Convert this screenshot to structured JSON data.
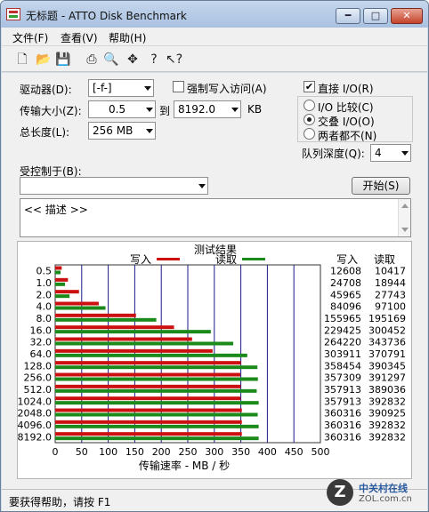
{
  "window": {
    "title": "无标题 - ATTO Disk Benchmark",
    "controls": {
      "minimize": "━",
      "maximize": "□",
      "close": "✕"
    }
  },
  "menu": [
    "文件(F)",
    "查看(V)",
    "帮助(H)"
  ],
  "toolbar_icons": [
    "new-icon",
    "open-icon",
    "save-icon",
    "print-icon",
    "print-preview-icon",
    "move-icon",
    "help-icon",
    "context-help-icon"
  ],
  "form": {
    "drive_label": "驱动器(D):",
    "drive_value": "[-f-]",
    "force_write_label": "强制写入访问(A)",
    "direct_io_label": "直接 I/O(R)",
    "transfer_size_label": "传输大小(Z):",
    "transfer_from": "0.5",
    "to_label": "到",
    "transfer_to": "8192.0",
    "kb_label": "KB",
    "total_length_label": "总长度(L):",
    "total_length_value": "256 MB",
    "radio_options": [
      "I/O 比较(C)",
      "交叠 I/O(O)",
      "两者都不(N)"
    ],
    "queue_depth_label": "队列深度(Q):",
    "queue_depth_value": "4",
    "controlled_by_label": "受控制于(B):",
    "controlled_by_value": "",
    "start_button": "开始(S)",
    "description": "<< 描述 >>"
  },
  "results": {
    "title": "测试结果",
    "legend_write": "写入",
    "legend_read": "读取",
    "col_write": "写入",
    "col_read": "读取",
    "xlabel": "传输速率 - MB / 秒"
  },
  "chart_data": {
    "type": "bar",
    "categories": [
      "0.5",
      "1.0",
      "2.0",
      "4.0",
      "8.0",
      "16.0",
      "32.0",
      "64.0",
      "128.0",
      "256.0",
      "512.0",
      "1024.0",
      "2048.0",
      "4096.0",
      "8192.0"
    ],
    "series": [
      {
        "name": "写入",
        "values": [
          12608,
          24708,
          45965,
          84096,
          155965,
          229425,
          264220,
          303911,
          358454,
          357309,
          357913,
          357913,
          360316,
          360316,
          360316
        ]
      },
      {
        "name": "读取",
        "values": [
          10417,
          18944,
          27743,
          97100,
          195169,
          300452,
          343736,
          370791,
          390345,
          391297,
          389036,
          392832,
          390925,
          392832,
          392832
        ]
      }
    ],
    "xlim": [
      0,
      500
    ],
    "xticks": [
      "0",
      "50",
      "100",
      "150",
      "200",
      "250",
      "300",
      "350",
      "400",
      "450",
      "500"
    ],
    "units_values": "KB/s",
    "xlabel": "传输速率 - MB / 秒",
    "colors": {
      "write": "#cc1010",
      "read": "#1a8a1a",
      "grid": "#1a1a8a"
    },
    "legend": "top"
  },
  "status": {
    "text": "要获得帮助，请按 F1"
  },
  "watermark": {
    "logo": "Z",
    "line1": "中关村在线",
    "line2": "ZOL.com.cn"
  }
}
